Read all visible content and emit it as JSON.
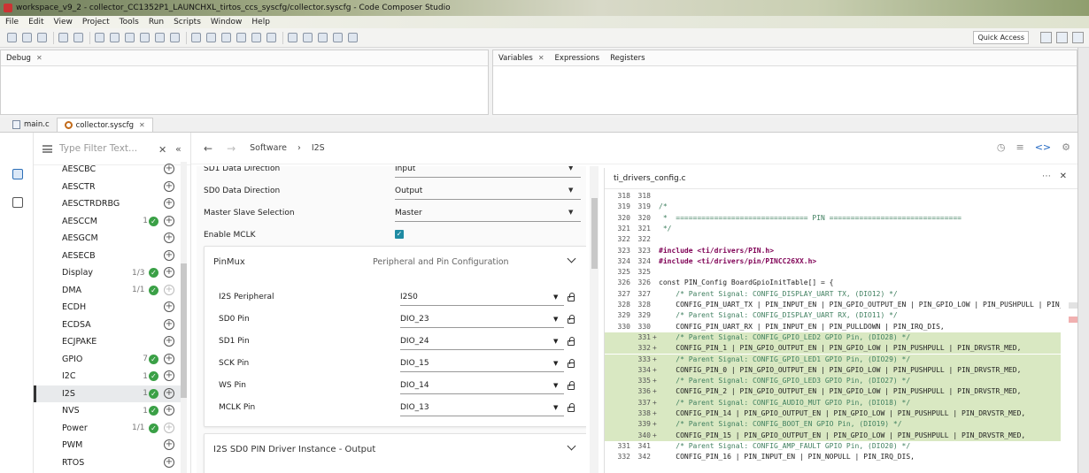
{
  "window": {
    "title": "workspace_v9_2 - collector_CC1352P1_LAUNCHXL_tirtos_ccs_syscfg/collector.syscfg - Code Composer Studio"
  },
  "menu": [
    "File",
    "Edit",
    "View",
    "Project",
    "Tools",
    "Run",
    "Scripts",
    "Window",
    "Help"
  ],
  "toolbar": {
    "quick_access": "Quick Access"
  },
  "debug_view": {
    "title": "Debug"
  },
  "var_views": {
    "variables": "Variables",
    "expressions": "Expressions",
    "registers": "Registers"
  },
  "editor_tabs": [
    {
      "label": "main.c"
    },
    {
      "label": "collector.syscfg"
    }
  ],
  "filter": {
    "placeholder": "Type Filter Text..."
  },
  "modules": [
    {
      "name": "AESCBC",
      "count": "",
      "ok": false
    },
    {
      "name": "AESCTR",
      "count": "",
      "ok": false
    },
    {
      "name": "AESCTRDRBG",
      "count": "",
      "ok": false
    },
    {
      "name": "AESCCM",
      "count": "1",
      "ok": true
    },
    {
      "name": "AESGCM",
      "count": "",
      "ok": false
    },
    {
      "name": "AESECB",
      "count": "",
      "ok": false
    },
    {
      "name": "Display",
      "count": "1/3",
      "ok": true
    },
    {
      "name": "DMA",
      "count": "1/1",
      "ok": true
    },
    {
      "name": "ECDH",
      "count": "",
      "ok": false
    },
    {
      "name": "ECDSA",
      "count": "",
      "ok": false
    },
    {
      "name": "ECJPAKE",
      "count": "",
      "ok": false
    },
    {
      "name": "GPIO",
      "count": "7",
      "ok": true
    },
    {
      "name": "I2C",
      "count": "1",
      "ok": true
    },
    {
      "name": "I2S",
      "count": "1",
      "ok": true
    },
    {
      "name": "NVS",
      "count": "1",
      "ok": true
    },
    {
      "name": "Power",
      "count": "1/1",
      "ok": true
    },
    {
      "name": "PWM",
      "count": "",
      "ok": false
    },
    {
      "name": "RTOS",
      "count": "",
      "ok": false
    }
  ],
  "nav": {
    "crumb1": "Software",
    "crumb2": "I2S"
  },
  "settings": [
    {
      "label": "SD1 Data Direction",
      "value": "Input"
    },
    {
      "label": "SD0 Data Direction",
      "value": "Output"
    },
    {
      "label": "Master Slave Selection",
      "value": "Master"
    },
    {
      "label": "Enable MCLK",
      "value": ""
    }
  ],
  "pinmux": {
    "title": "PinMux",
    "subtitle": "Peripheral and Pin Configuration",
    "rows": [
      {
        "label": "I2S Peripheral",
        "value": "I2S0"
      },
      {
        "label": "SD0 Pin",
        "value": "DIO_23"
      },
      {
        "label": "SD1 Pin",
        "value": "DIO_24"
      },
      {
        "label": "SCK Pin",
        "value": "DIO_15"
      },
      {
        "label": "WS Pin",
        "value": "DIO_14"
      },
      {
        "label": "MCLK Pin",
        "value": "DIO_13"
      }
    ]
  },
  "driver_card": {
    "title": "I2S SD0 PIN Driver Instance - Output"
  },
  "code_view": {
    "filename": "ti_drivers_config.c",
    "lines": [
      {
        "n1": "318",
        "n2": "318",
        "text": "",
        "hl": false,
        "plus": false
      },
      {
        "n1": "319",
        "n2": "319",
        "text": "/*",
        "hl": false,
        "plus": false
      },
      {
        "n1": "320",
        "n2": "320",
        "text": " *  =============================== PIN ===============================",
        "hl": false,
        "plus": false
      },
      {
        "n1": "321",
        "n2": "321",
        "text": " */",
        "hl": false,
        "plus": false
      },
      {
        "n1": "322",
        "n2": "322",
        "text": "",
        "hl": false,
        "plus": false
      },
      {
        "n1": "323",
        "n2": "323",
        "text": "#include <ti/drivers/PIN.h>",
        "hl": false,
        "plus": false
      },
      {
        "n1": "324",
        "n2": "324",
        "text": "#include <ti/drivers/pin/PINCC26XX.h>",
        "hl": false,
        "plus": false
      },
      {
        "n1": "325",
        "n2": "325",
        "text": "",
        "hl": false,
        "plus": false
      },
      {
        "n1": "326",
        "n2": "326",
        "text": "const PIN_Config BoardGpioInitTable[] = {",
        "hl": false,
        "plus": false
      },
      {
        "n1": "327",
        "n2": "327",
        "text": "    /* Parent Signal: CONFIG_DISPLAY_UART TX, (DIO12) */",
        "hl": false,
        "plus": false
      },
      {
        "n1": "328",
        "n2": "328",
        "text": "    CONFIG_PIN_UART_TX | PIN_INPUT_EN | PIN_GPIO_OUTPUT_EN | PIN_GPIO_LOW | PIN_PUSHPULL | PIN_DRVSTR_MED",
        "hl": false,
        "plus": false
      },
      {
        "n1": "329",
        "n2": "329",
        "text": "    /* Parent Signal: CONFIG_DISPLAY_UART RX, (DIO11) */",
        "hl": false,
        "plus": false
      },
      {
        "n1": "330",
        "n2": "330",
        "text": "    CONFIG_PIN_UART_RX | PIN_INPUT_EN | PIN_PULLDOWN | PIN_IRQ_DIS,",
        "hl": false,
        "plus": false
      },
      {
        "n1": "",
        "n2": "331",
        "text": "    /* Parent Signal: CONFIG_GPIO_LED2 GPIO Pin, (DIO28) */",
        "hl": true,
        "plus": true
      },
      {
        "n1": "",
        "n2": "332",
        "text": "    CONFIG_PIN_1 | PIN_GPIO_OUTPUT_EN | PIN_GPIO_LOW | PIN_PUSHPULL | PIN_DRVSTR_MED,",
        "hl": true,
        "plus": true
      },
      {
        "n1": "",
        "n2": "333",
        "text": "    /* Parent Signal: CONFIG_GPIO_LED1 GPIO Pin, (DIO29) */",
        "hl": true,
        "plus": true
      },
      {
        "n1": "",
        "n2": "334",
        "text": "    CONFIG_PIN_0 | PIN_GPIO_OUTPUT_EN | PIN_GPIO_LOW | PIN_PUSHPULL | PIN_DRVSTR_MED,",
        "hl": true,
        "plus": true
      },
      {
        "n1": "",
        "n2": "335",
        "text": "    /* Parent Signal: CONFIG_GPIO_LED3 GPIO Pin, (DIO27) */",
        "hl": true,
        "plus": true
      },
      {
        "n1": "",
        "n2": "336",
        "text": "    CONFIG_PIN_2 | PIN_GPIO_OUTPUT_EN | PIN_GPIO_LOW | PIN_PUSHPULL | PIN_DRVSTR_MED,",
        "hl": true,
        "plus": true
      },
      {
        "n1": "",
        "n2": "337",
        "text": "    /* Parent Signal: CONFIG_AUDIO_MUT GPIO Pin, (DIO18) */",
        "hl": true,
        "plus": true
      },
      {
        "n1": "",
        "n2": "338",
        "text": "    CONFIG_PIN_14 | PIN_GPIO_OUTPUT_EN | PIN_GPIO_LOW | PIN_PUSHPULL | PIN_DRVSTR_MED,",
        "hl": true,
        "plus": true
      },
      {
        "n1": "",
        "n2": "339",
        "text": "    /* Parent Signal: CONFIG_BOOT_EN GPIO Pin, (DIO19) */",
        "hl": true,
        "plus": true
      },
      {
        "n1": "",
        "n2": "340",
        "text": "    CONFIG_PIN_15 | PIN_GPIO_OUTPUT_EN | PIN_GPIO_LOW | PIN_PUSHPULL | PIN_DRVSTR_MED,",
        "hl": true,
        "plus": true
      },
      {
        "n1": "331",
        "n2": "341",
        "text": "    /* Parent Signal: CONFIG_AMP_FAULT GPIO Pin, (DIO20) */",
        "hl": false,
        "plus": false
      },
      {
        "n1": "332",
        "n2": "342",
        "text": "    CONFIG_PIN_16 | PIN_INPUT_EN | PIN_NOPULL | PIN_IRQ_DIS,",
        "hl": false,
        "plus": false
      }
    ]
  }
}
